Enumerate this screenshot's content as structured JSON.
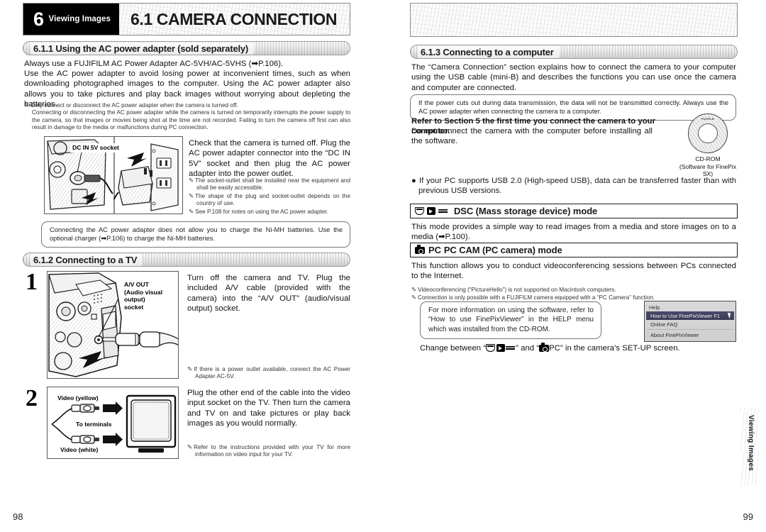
{
  "left_page": {
    "chapter": {
      "number": "6",
      "tab_label": "Viewing Images",
      "title": "6.1 CAMERA CONNECTION"
    },
    "page_number": "98",
    "section_611": {
      "heading": "6.1.1 Using the AC power adapter (sold separately)",
      "para1": "Always use a FUJIFILM AC Power Adapter AC-5VH/AC-5VHS (➡P.106).",
      "para2": "Use the AC power adapter to avoid losing power at inconvenient times, such as when downloading photographed images to the computer. Using the AC power adapter also allows you to take pictures and play back images without worrying about depleting the batteries.",
      "note1_line1": "Only connect or disconnect the AC power adapter when the camera is turned off.",
      "note1_line2": "Connecting or disconnecting the AC power adapter while the camera is turned on temporarily interrupts the power supply to the camera, so that images or movies being shot at the time are not recorded. Failing to turn the camera off first can also result in damage to the media or malfunctions during PC connection.",
      "figure_label": "DC IN 5V socket",
      "instruction": "Check that the camera is turned off. Plug the AC power adapter connector into the “DC IN 5V” socket and then plug the AC power adapter into the power outlet.",
      "fig_notes": [
        "The socket-outlet shall be installed near the equipment and shall be easily accessible.",
        "The shape of the plug and socket-outlet depends on the country of use.",
        "See P.108 for notes on using the AC power adapter."
      ],
      "callout": "Connecting the AC power adapter does not allow you to charge the Ni-MH batteries. Use the optional charger (➡P.106) to charge the Ni-MH batteries."
    },
    "section_612": {
      "heading": "6.1.2 Connecting to a TV",
      "step1": {
        "number": "1",
        "fig_label_l1": "A/V OUT",
        "fig_label_l2": "(Audio visual output)",
        "fig_label_l3": "socket",
        "text": "Turn off the camera and TV. Plug the included A/V cable (provided with the camera) into the “A/V OUT” (audio/visual output) socket.",
        "note": "If there is a power outlet available, connect the AC Power Adapter AC-5V."
      },
      "step2": {
        "number": "2",
        "label_yellow": "Video (yellow)",
        "label_terminals": "To terminals",
        "label_white": "Video (white)",
        "text": "Plug the other end of the cable into the video input socket on the TV. Then turn the camera and TV on and take pictures or play back images as you would normally.",
        "note": "Refer to the instructions provided with your TV for more information on video input for your TV."
      }
    }
  },
  "right_page": {
    "page_number": "99",
    "side_tab": "Viewing Images",
    "section_613": {
      "heading": "6.1.3 Connecting to a computer",
      "para1": "The “Camera Connection” section explains how to connect the camera to your computer using the USB cable (mini-B) and describes the functions you can use once the camera and computer are connected.",
      "callout1": "If the power cuts out during data transmission, the data will not be transmitted correctly. Always use the AC power adapter when connecting the camera to a computer.",
      "bold_note": "Refer to Section 5 the first time you connect the camera to your computer.",
      "bold_note_body": "Do not connect the camera with the computer before installing all the software.",
      "cd_caption_l1": "CD-ROM",
      "cd_caption_l2": "(Software for FinePix SX)",
      "cd_label_brand": "FUJIFILM",
      "usb_bullet": "If your PC supports USB 2.0 (High-speed USB), data can be transferred faster than with previous USB versions."
    },
    "dsc_mode": {
      "icons": [
        "playback-icon",
        "movie-icon",
        "transfer-arrows-icon"
      ],
      "heading": "DSC (Mass storage device) mode",
      "body": "This mode provides a simple way to read images from a media and store images on to a media (➡P.100)."
    },
    "pccam_mode": {
      "icon": "camera-icon",
      "heading_prefix": "PC",
      "heading": "PC CAM (PC camera) mode",
      "body": "This function allows you to conduct videoconferencing sessions between PCs connected to the Internet.",
      "notes": [
        "Videoconferencing (“PictureHello”) is not supported on Macintosh computers.",
        "Connection is only possible with a FUJIFILM camera equipped with a “PC Camera” function."
      ],
      "callout": "For more information on using the software, refer to “How to use FinePixViewer” in the HELP menu which was installed from the CD-ROM.",
      "help_menu": {
        "title": "Help",
        "items": [
          "How to Use FinePixViewer  F1",
          "Online FAQ",
          "About FinePixViewer"
        ],
        "selected_index": 0
      },
      "change_line_pre": "Change between “",
      "change_line_mid": "” and “",
      "change_line_pc": "PC",
      "change_line_post": "” in the camera’s SET-UP screen."
    }
  }
}
